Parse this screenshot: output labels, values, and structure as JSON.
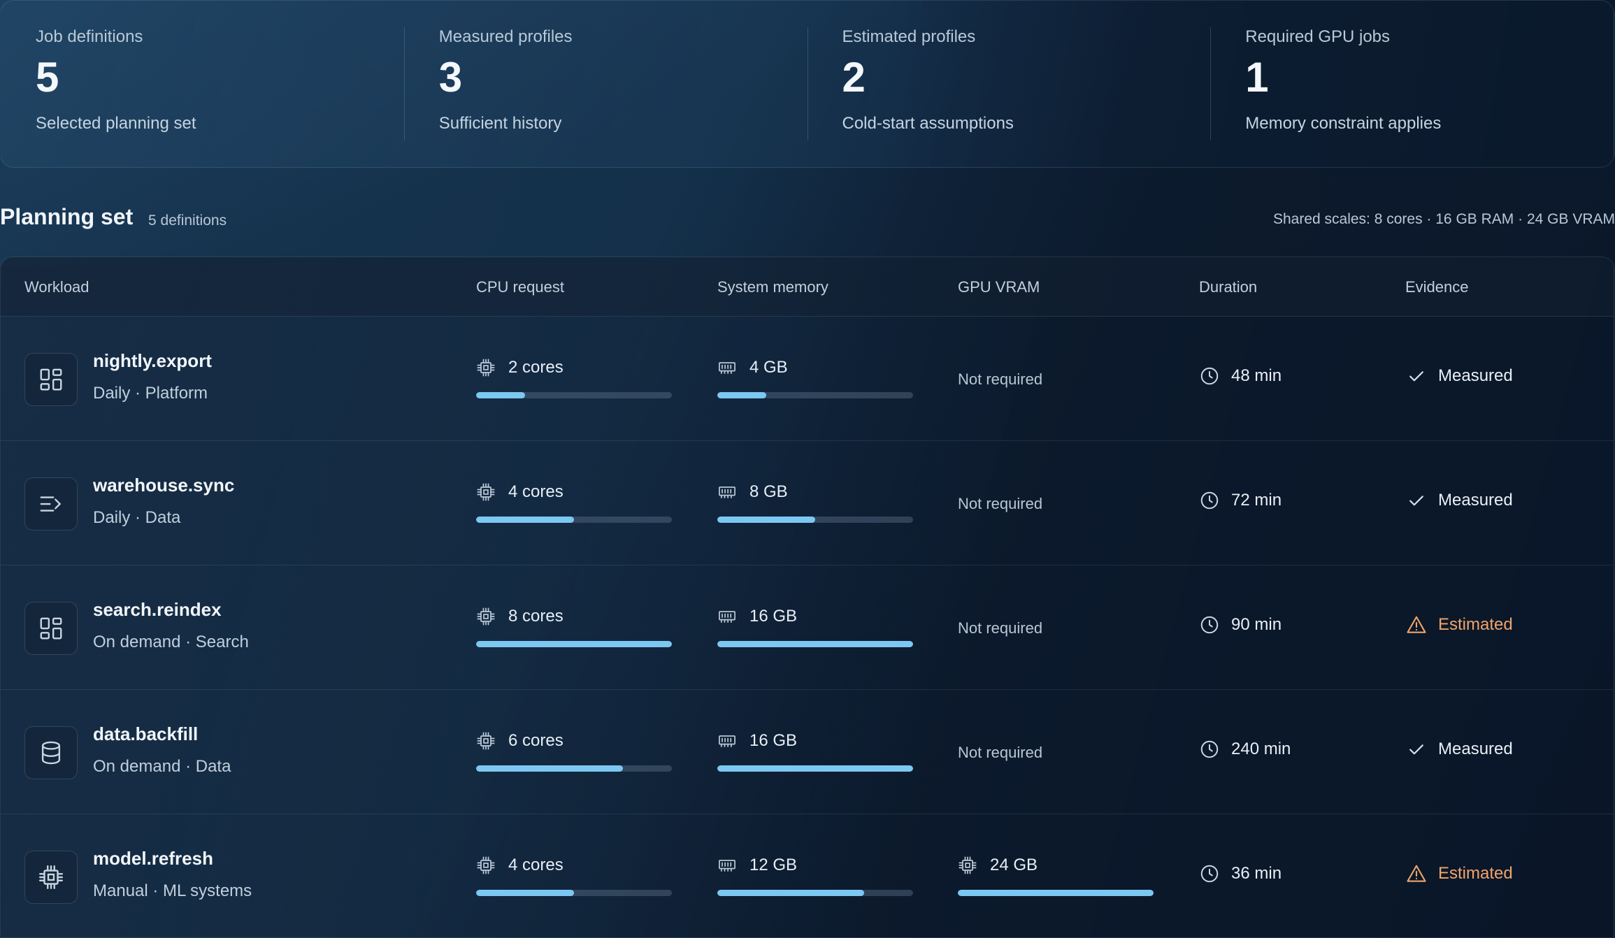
{
  "stats": [
    {
      "label": "Job definitions",
      "value": "5",
      "sub": "Selected planning set"
    },
    {
      "label": "Measured profiles",
      "value": "3",
      "sub": "Sufficient history"
    },
    {
      "label": "Estimated profiles",
      "value": "2",
      "sub": "Cold-start assumptions"
    },
    {
      "label": "Required GPU jobs",
      "value": "1",
      "sub": "Memory constraint applies"
    }
  ],
  "planning": {
    "title": "Planning set",
    "count": "5 definitions",
    "scales": "Shared scales: 8 cores · 16 GB RAM · 24 GB VRAM"
  },
  "table": {
    "headers": {
      "workload": "Workload",
      "cpu": "CPU request",
      "memory": "System memory",
      "gpu": "GPU VRAM",
      "duration": "Duration",
      "evidence": "Evidence"
    },
    "rows": [
      {
        "icon": "dashboard-icon",
        "name": "nightly.export",
        "meta": "Daily · Platform",
        "cpu": "2 cores",
        "cpu_fraction": 0.25,
        "mem": "4 GB",
        "mem_fraction": 0.25,
        "gpu": "Not required",
        "duration": "48 min",
        "evidence": "Measured"
      },
      {
        "icon": "list-arrow-icon",
        "name": "warehouse.sync",
        "meta": "Daily · Data",
        "cpu": "4 cores",
        "cpu_fraction": 0.5,
        "mem": "8 GB",
        "mem_fraction": 0.5,
        "gpu": "Not required",
        "duration": "72 min",
        "evidence": "Measured"
      },
      {
        "icon": "dashboard-icon",
        "name": "search.reindex",
        "meta": "On demand · Search",
        "cpu": "8 cores",
        "cpu_fraction": 1.0,
        "mem": "16 GB",
        "mem_fraction": 1.0,
        "gpu": "Not required",
        "duration": "90 min",
        "evidence": "Estimated"
      },
      {
        "icon": "database-icon",
        "name": "data.backfill",
        "meta": "On demand · Data",
        "cpu": "6 cores",
        "cpu_fraction": 0.75,
        "mem": "16 GB",
        "mem_fraction": 1.0,
        "gpu": "Not required",
        "duration": "240 min",
        "evidence": "Measured"
      },
      {
        "icon": "chip-icon",
        "name": "model.refresh",
        "meta": "Manual · ML systems",
        "cpu": "4 cores",
        "cpu_fraction": 0.5,
        "mem": "12 GB",
        "mem_fraction": 0.75,
        "gpu": "24 GB",
        "gpu_fraction": 1.0,
        "duration": "36 min",
        "evidence": "Estimated"
      }
    ]
  },
  "colors": {
    "bar_fill": "#7cc8f2",
    "estimated": "#f0a46a",
    "icon_stroke": "#c9d6e2"
  }
}
